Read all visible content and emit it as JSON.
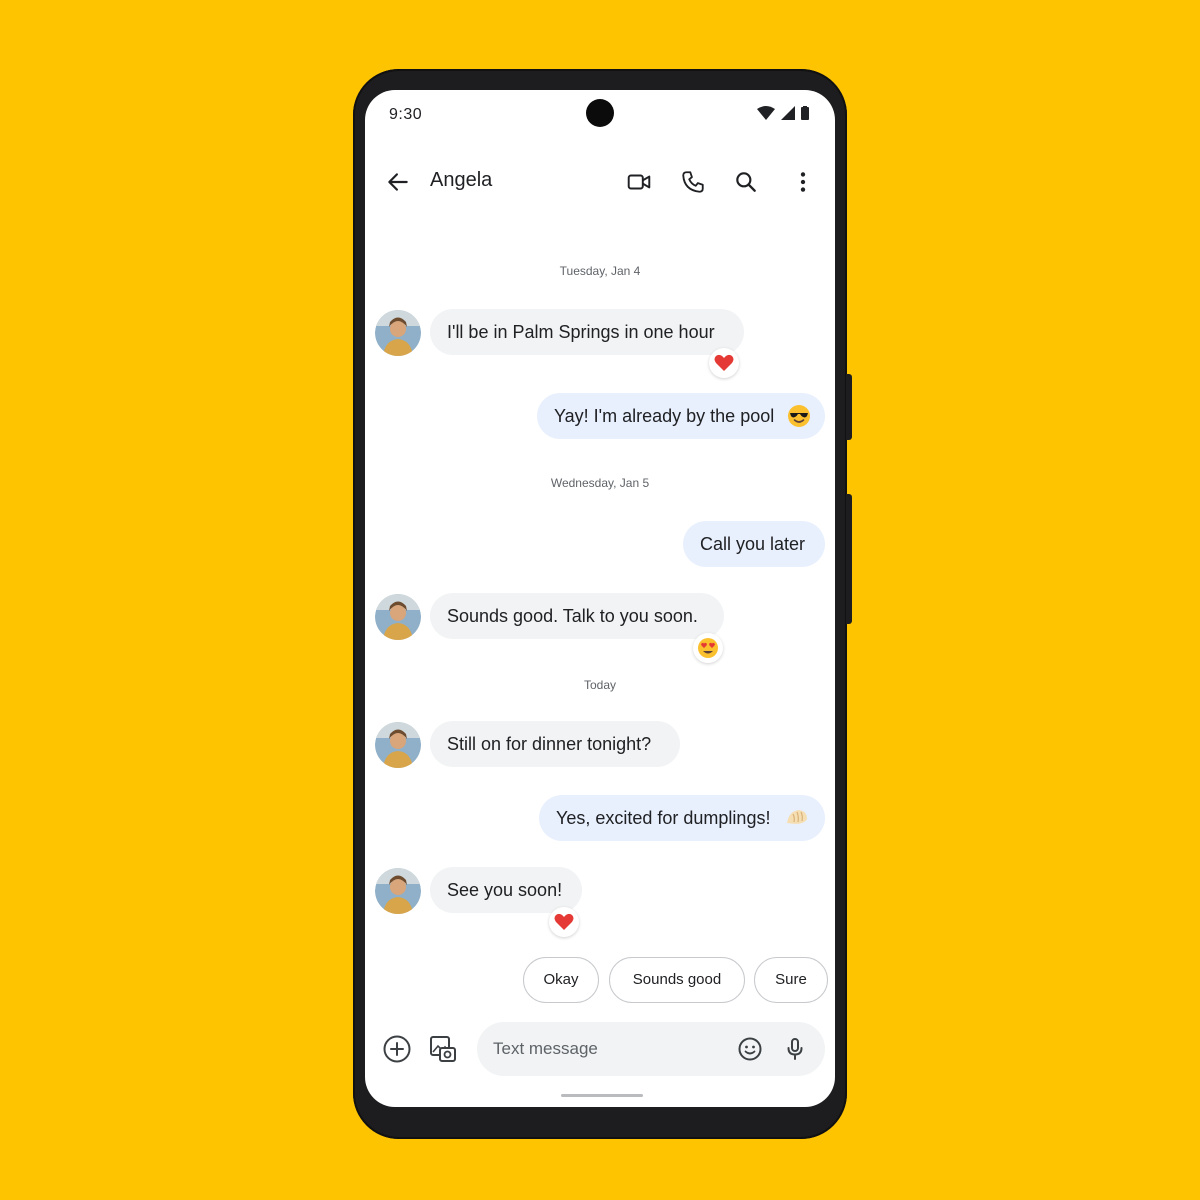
{
  "status_bar": {
    "time": "9:30"
  },
  "header": {
    "contact_name": "Angela",
    "icons": [
      "back-arrow-icon",
      "video-call-icon",
      "phone-icon",
      "search-icon",
      "more-vert-icon"
    ]
  },
  "conversation": {
    "date_separators": [
      "Tuesday, Jan 4",
      "Wednesday, Jan 5",
      "Today"
    ],
    "messages": [
      {
        "direction": "incoming",
        "text": "I'll be in Palm Springs in one hour",
        "reaction": "red-heart"
      },
      {
        "direction": "outgoing",
        "text": "Yay! I'm already by the pool",
        "emoji": "smiling-face-with-sunglasses"
      },
      {
        "direction": "outgoing",
        "text": "Call you later"
      },
      {
        "direction": "incoming",
        "text": "Sounds good. Talk to you soon.",
        "reaction": "heart-eyes"
      },
      {
        "direction": "incoming",
        "text": "Still on for dinner tonight?"
      },
      {
        "direction": "outgoing",
        "text": "Yes, excited for dumplings!",
        "emoji": "dumpling"
      },
      {
        "direction": "incoming",
        "text": "See you soon!",
        "reaction": "red-heart"
      }
    ]
  },
  "suggestions": [
    "Okay",
    "Sounds good",
    "Sure"
  ],
  "compose": {
    "placeholder": "Text message",
    "icons": [
      "add-circle-icon",
      "gallery-icon",
      "emoji-icon",
      "microphone-icon"
    ]
  },
  "colors": {
    "background": "#FFC400",
    "incoming_bubble": "#f1f3f4",
    "outgoing_bubble": "#e8f0fe",
    "heart": "#e53935"
  }
}
